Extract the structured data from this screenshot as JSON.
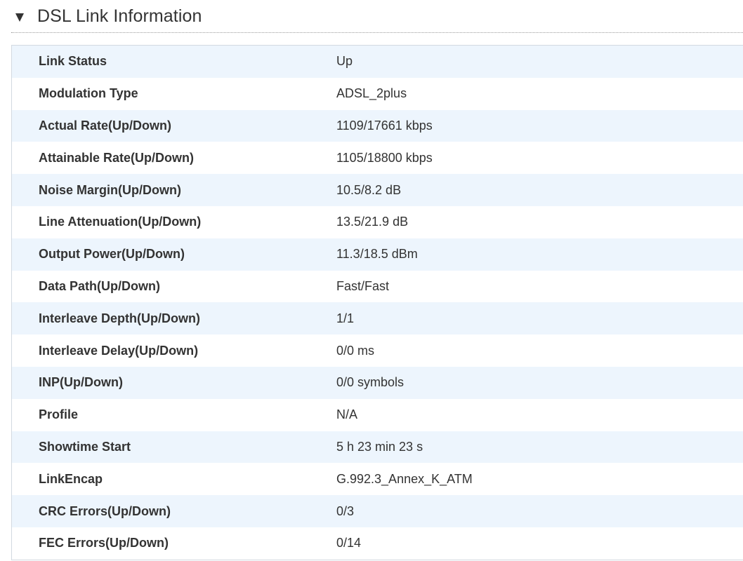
{
  "section": {
    "title": "DSL Link Information"
  },
  "rows": [
    {
      "label": "Link Status",
      "value": "Up"
    },
    {
      "label": "Modulation Type",
      "value": "ADSL_2plus"
    },
    {
      "label": "Actual Rate(Up/Down)",
      "value": "1109/17661 kbps"
    },
    {
      "label": "Attainable Rate(Up/Down)",
      "value": "1105/18800 kbps"
    },
    {
      "label": "Noise Margin(Up/Down)",
      "value": "10.5/8.2 dB"
    },
    {
      "label": "Line Attenuation(Up/Down)",
      "value": "13.5/21.9 dB"
    },
    {
      "label": "Output Power(Up/Down)",
      "value": "11.3/18.5 dBm"
    },
    {
      "label": "Data Path(Up/Down)",
      "value": "Fast/Fast"
    },
    {
      "label": "Interleave Depth(Up/Down)",
      "value": "1/1"
    },
    {
      "label": "Interleave Delay(Up/Down)",
      "value": "0/0 ms"
    },
    {
      "label": "INP(Up/Down)",
      "value": "0/0 symbols"
    },
    {
      "label": "Profile",
      "value": "N/A"
    },
    {
      "label": "Showtime Start",
      "value": "5 h 23 min 23 s"
    },
    {
      "label": "LinkEncap",
      "value": "G.992.3_Annex_K_ATM"
    },
    {
      "label": "CRC Errors(Up/Down)",
      "value": "0/3"
    },
    {
      "label": "FEC Errors(Up/Down)",
      "value": "0/14"
    }
  ],
  "colors": {
    "row_alt_bg": "#edf5fd",
    "text": "#333333",
    "border": "#d2d9e0"
  },
  "icons": {
    "collapse": "triangle-down-icon"
  }
}
